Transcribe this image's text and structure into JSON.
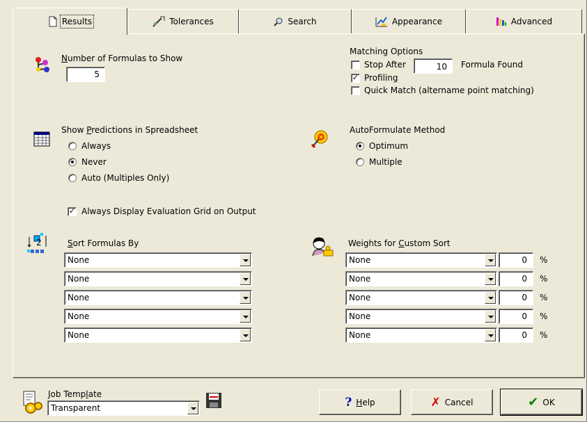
{
  "tabs": [
    {
      "label": "Results",
      "icon": "results-icon",
      "active": true
    },
    {
      "label": "Tolerances",
      "icon": "tolerances-icon"
    },
    {
      "label": "Search",
      "icon": "search-icon"
    },
    {
      "label": "Appearance",
      "icon": "appearance-icon"
    },
    {
      "label": "Advanced",
      "icon": "advanced-icon"
    }
  ],
  "formulas": {
    "label_u": "N",
    "label_rest": "umber of Formulas to Show",
    "value": "5"
  },
  "matching": {
    "title": "Matching Options",
    "stop_after": {
      "label": "Stop After",
      "checked": false,
      "value": "10",
      "suffix": "Formula Found"
    },
    "profiling": {
      "label": "Profiling",
      "checked": true
    },
    "quick_match": {
      "label": "Quick Match (altername point matching)",
      "checked": false
    }
  },
  "predictions": {
    "label_pre": "Show ",
    "label_u": "P",
    "label_rest": "redictions in Spreadsheet",
    "options": [
      "Always",
      "Never",
      "Auto (Multiples Only)"
    ],
    "selected": "Never"
  },
  "autoformulate": {
    "title": "AutoFormulate Method",
    "options": [
      "Optimum",
      "Multiple"
    ],
    "selected": "Optimum"
  },
  "eval_grid": {
    "label": "Always Display Evaluation Grid on Output",
    "checked": true
  },
  "sort": {
    "label_u": "S",
    "label_rest": "ort Formulas By",
    "rows": [
      "None",
      "None",
      "None",
      "None",
      "None"
    ]
  },
  "weights": {
    "label_pre": "Weights for ",
    "label_u": "C",
    "label_rest": "ustom Sort",
    "rows": [
      {
        "value": "None",
        "pct": "0"
      },
      {
        "value": "None",
        "pct": "0"
      },
      {
        "value": "None",
        "pct": "0"
      },
      {
        "value": "None",
        "pct": "0"
      },
      {
        "value": "None",
        "pct": "0"
      }
    ],
    "pct_sign": "%"
  },
  "job_template": {
    "label_pre": "Job Temp",
    "label_u": "l",
    "label_rest": "ate",
    "value": "Transparent"
  },
  "buttons": {
    "help_u": "H",
    "help_rest": "elp",
    "cancel": "Cancel",
    "ok": "OK"
  },
  "colors": {
    "face": "#ece9d8",
    "cancel_x": "#cc0000",
    "ok_check": "#008000"
  }
}
